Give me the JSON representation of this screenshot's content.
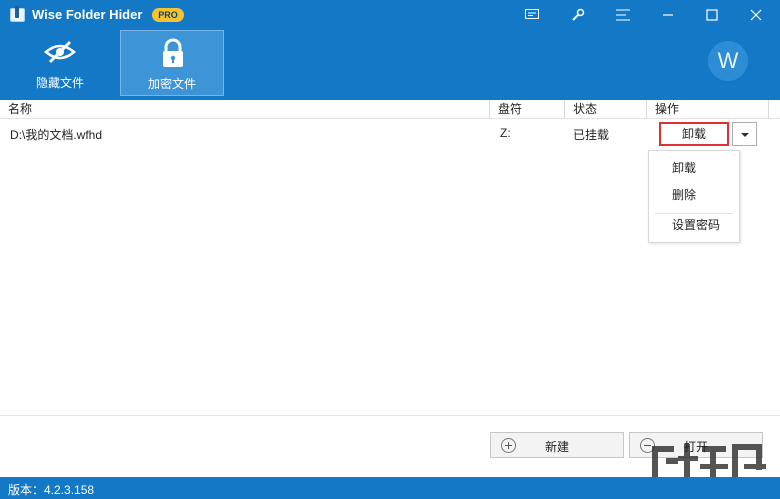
{
  "titlebar": {
    "title": "Wise Folder Hider",
    "badge": "PRO"
  },
  "toolbar": {
    "hide_files_label": "隐藏文件",
    "encrypt_files_label": "加密文件",
    "avatar_letter": "W"
  },
  "table": {
    "headers": [
      "名称",
      "盘符",
      "状态",
      "操作"
    ],
    "rows": [
      {
        "name": "D:\\我的文档.wfhd",
        "drive": "Z:",
        "status": "已挂载",
        "action": "卸载"
      }
    ]
  },
  "menu": {
    "items": [
      "卸载",
      "删除",
      "设置密码"
    ]
  },
  "buttons": {
    "new_label": "新建",
    "open_label": "打开"
  },
  "statusbar": {
    "version": "版本：4.2.3.158"
  },
  "colors": {
    "accent": "#1378c6",
    "highlight_border": "#e03030",
    "badge": "#f4c430"
  }
}
